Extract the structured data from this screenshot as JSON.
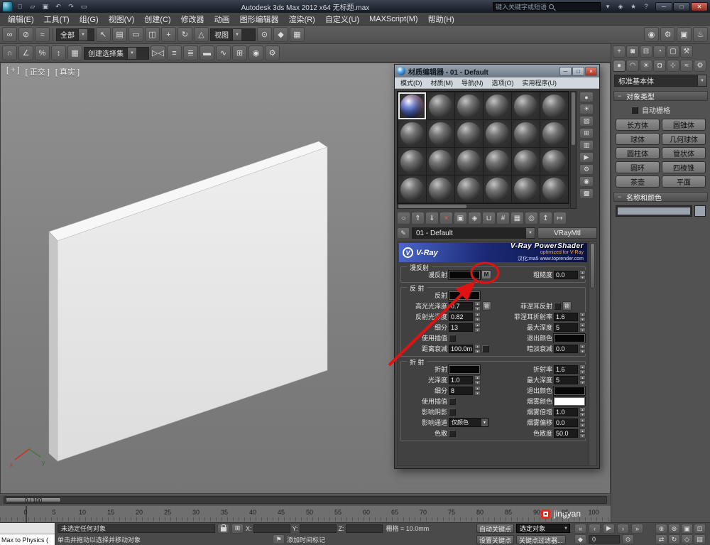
{
  "colors": {
    "annotation": "#e01212",
    "vray_banner_blue": "#16246e",
    "selected_slot_border": "#e8e8e8"
  },
  "titlebar": {
    "title": "Autodesk 3ds Max  2012 x64  无标题.max",
    "search_placeholder": "键入关键字或短语",
    "qat": [
      {
        "name": "new-scene-icon",
        "glyph": "□"
      },
      {
        "name": "open-file-icon",
        "glyph": "▱"
      },
      {
        "name": "save-file-icon",
        "glyph": "▣"
      },
      {
        "name": "undo-icon",
        "glyph": "↶"
      },
      {
        "name": "redo-icon",
        "glyph": "↷"
      },
      {
        "name": "project-folder-icon",
        "glyph": "▭"
      }
    ],
    "right_icons": [
      {
        "name": "search-dropdown-icon",
        "glyph": "▾"
      },
      {
        "name": "communication-center-icon",
        "glyph": "◈"
      },
      {
        "name": "favorites-star-icon",
        "glyph": "★"
      },
      {
        "name": "help-icon",
        "glyph": "?"
      }
    ],
    "window_buttons": [
      {
        "name": "minimize-button",
        "glyph": "─"
      },
      {
        "name": "maximize-button",
        "glyph": "□"
      },
      {
        "name": "close-button",
        "glyph": "✕",
        "cls": "close"
      }
    ]
  },
  "menubar": [
    "编辑(E)",
    "工具(T)",
    "组(G)",
    "视图(V)",
    "创建(C)",
    "修改器",
    "动画",
    "图形编辑器",
    "渲染(R)",
    "自定义(U)",
    "MAXScript(M)",
    "帮助(H)"
  ],
  "toolbar1": {
    "filter_value": "全部",
    "coordsys_value": "视图",
    "group1": [
      {
        "name": "select-and-link-icon",
        "glyph": "∞"
      },
      {
        "name": "unlink-selection-icon",
        "glyph": "⊘"
      },
      {
        "name": "bind-to-space-warp-icon",
        "glyph": "≈"
      }
    ],
    "group2": [
      {
        "name": "select-object-icon",
        "glyph": "↖"
      },
      {
        "name": "select-by-name-icon",
        "glyph": "▤"
      },
      {
        "name": "selection-region-icon",
        "glyph": "▭"
      },
      {
        "name": "window-crossing-icon",
        "glyph": "◫"
      },
      {
        "name": "select-and-move-icon",
        "glyph": "+"
      },
      {
        "name": "select-and-rotate-icon",
        "glyph": "↻"
      },
      {
        "name": "select-and-scale-icon",
        "glyph": "△"
      }
    ],
    "group3": [
      {
        "name": "use-pivot-center-icon",
        "glyph": "⊙"
      },
      {
        "name": "select-and-manipulate-icon",
        "glyph": "◆"
      },
      {
        "name": "keyboard-override-icon",
        "glyph": "▦"
      }
    ],
    "group4": [
      {
        "name": "material-editor-icon",
        "glyph": "◉"
      },
      {
        "name": "render-setup-icon",
        "glyph": "⚙"
      },
      {
        "name": "rendered-frame-window-icon",
        "glyph": "▣"
      },
      {
        "name": "render-production-icon",
        "glyph": "♨"
      }
    ]
  },
  "toolbar2": {
    "selection_set_value": "创建选择集",
    "group1": [
      {
        "name": "snap-toggle-icon",
        "glyph": "∩"
      },
      {
        "name": "angle-snap-icon",
        "glyph": "∠"
      },
      {
        "name": "percent-snap-icon",
        "glyph": "%"
      },
      {
        "name": "spinner-snap-icon",
        "glyph": "↕"
      },
      {
        "name": "edit-named-selection-sets-icon",
        "glyph": "▦"
      }
    ],
    "group2": [
      {
        "name": "mirror-icon",
        "glyph": "▷◁"
      },
      {
        "name": "align-icon",
        "glyph": "≡"
      },
      {
        "name": "layer-manager-icon",
        "glyph": "≣"
      },
      {
        "name": "graphite-ribbon-icon",
        "glyph": "▬"
      },
      {
        "name": "curve-editor-icon",
        "glyph": "∿"
      },
      {
        "name": "schematic-view-icon",
        "glyph": "⊞"
      },
      {
        "name": "material-editor-icon",
        "glyph": "◉"
      },
      {
        "name": "render-setup-icon",
        "glyph": "⚙"
      }
    ]
  },
  "viewport": {
    "label_items": [
      "[ + ]",
      "[ 正交 ]",
      "[ 真实 ]"
    ],
    "axis_x": "x",
    "axis_y": "y"
  },
  "material_editor": {
    "title": "材质编辑器 - 01 - Default",
    "menu": [
      "模式(D)",
      "材质(M)",
      "导航(N)",
      "选项(O)",
      "实用程序(U)"
    ],
    "window_buttons": [
      {
        "name": "me-minimize-button",
        "glyph": "─"
      },
      {
        "name": "me-maximize-button",
        "glyph": "□"
      },
      {
        "name": "me-close-button",
        "glyph": "×",
        "cls": "close"
      }
    ],
    "slots": {
      "rows": 4,
      "cols": 6
    },
    "side_tools": [
      {
        "name": "sample-type-icon",
        "glyph": "●"
      },
      {
        "name": "backlight-icon",
        "glyph": "☀"
      },
      {
        "name": "background-icon",
        "glyph": "▨"
      },
      {
        "name": "sample-tiling-icon",
        "glyph": "⊞"
      },
      {
        "name": "video-color-check-icon",
        "glyph": "▥"
      },
      {
        "name": "make-preview-icon",
        "glyph": "▶"
      },
      {
        "name": "options-icon",
        "glyph": "⚙"
      },
      {
        "name": "select-by-material-icon",
        "glyph": "◉"
      },
      {
        "name": "material-map-navigator-icon",
        "glyph": "▩"
      }
    ],
    "toolbar": [
      {
        "name": "get-material-icon",
        "glyph": "○"
      },
      {
        "name": "put-material-to-scene-icon",
        "glyph": "⇑"
      },
      {
        "name": "assign-material-to-selection-icon",
        "glyph": "⇓"
      },
      {
        "name": "reset-map-icon",
        "glyph": "×",
        "color": "#ff5a4a"
      },
      {
        "name": "make-material-copy-icon",
        "glyph": "▣"
      },
      {
        "name": "make-unique-icon",
        "glyph": "◈"
      },
      {
        "name": "put-to-library-icon",
        "glyph": "⊔"
      },
      {
        "name": "material-id-channel-icon",
        "glyph": "#"
      },
      {
        "name": "show-map-in-viewport-icon",
        "glyph": "▦"
      },
      {
        "name": "show-end-result-icon",
        "glyph": "◎"
      },
      {
        "name": "go-to-parent-icon",
        "glyph": "↥"
      },
      {
        "name": "go-forward-to-sibling-icon",
        "glyph": "↦"
      }
    ],
    "pick_tool": [
      {
        "name": "pick-material-from-object-icon",
        "glyph": "✎"
      }
    ],
    "material_name": "01 - Default",
    "material_type": "VRayMtl",
    "banner": {
      "logo_letter": "V",
      "logo_text": "V-Ray",
      "title": "V-Ray PowerShader",
      "subtitle": "optimized for V-Ray",
      "line2": "汉化:ma5  www.toprender.com"
    },
    "diffuse": {
      "header": "漫反射",
      "rows": [
        {
          "left": {
            "label": "漫反射",
            "swatch": "#070707",
            "map": "M",
            "map_name": "diffuse-map-button"
          },
          "right": {
            "label": "粗糙度",
            "value": "0.0"
          }
        }
      ]
    },
    "reflection": {
      "header": "反 射",
      "rows": [
        {
          "left": {
            "label": "反射",
            "swatch": "#070707"
          },
          "right": null
        },
        {
          "left": {
            "label": "高光光泽度",
            "value": "0.7",
            "lock": "锁"
          },
          "right": {
            "label": "菲涅耳反射",
            "checkbox": true,
            "lock": "锁"
          }
        },
        {
          "left": {
            "label": "反射光泽度",
            "value": "0.82"
          },
          "right": {
            "label": "菲涅耳折射率",
            "value": "1.6"
          }
        },
        {
          "left": {
            "label": "细分",
            "value": "13"
          },
          "right": {
            "label": "最大深度",
            "value": "5"
          }
        },
        {
          "left": {
            "label": "使用插值",
            "checkbox": true
          },
          "right": {
            "label": "退出颜色",
            "swatch": "#070707"
          }
        },
        {
          "left": {
            "label": "距离衰减",
            "value": "100.0m",
            "checkbox": true
          },
          "right": {
            "label": "暗淡衰减",
            "value": "0.0"
          }
        }
      ]
    },
    "refraction": {
      "header": "折 射",
      "rows": [
        {
          "left": {
            "label": "折射",
            "swatch": "#070707"
          },
          "right": {
            "label": "折射率",
            "value": "1.6"
          }
        },
        {
          "left": {
            "label": "光泽度",
            "value": "1.0"
          },
          "right": {
            "label": "最大深度",
            "value": "5"
          }
        },
        {
          "left": {
            "label": "细分",
            "value": "8"
          },
          "right": {
            "label": "退出颜色",
            "swatch": "#070707"
          }
        },
        {
          "left": {
            "label": "使用插值",
            "checkbox": true
          },
          "right": {
            "label": "烟雾颜色",
            "swatch": "#ffffff"
          }
        },
        {
          "left": {
            "label": "影响阴影",
            "checkbox": true
          },
          "right": {
            "label": "烟雾倍增",
            "value": "1.0"
          }
        },
        {
          "left": {
            "label": "影响通道",
            "dropdown": "仅颜色"
          },
          "right": {
            "label": "烟雾偏移",
            "value": "0.0"
          }
        },
        {
          "left": {
            "label": "色散",
            "checkbox": true
          },
          "right": {
            "label": "色散度",
            "value": "50.0"
          }
        }
      ]
    }
  },
  "command_panel": {
    "tabs": [
      {
        "name": "tab-create-icon",
        "glyph": "+"
      },
      {
        "name": "tab-modify-icon",
        "glyph": "◙"
      },
      {
        "name": "tab-hierarchy-icon",
        "glyph": "⊟"
      },
      {
        "name": "tab-motion-icon",
        "glyph": "◔"
      },
      {
        "name": "tab-display-icon",
        "glyph": "▢"
      },
      {
        "name": "tab-utilities-icon",
        "glyph": "⚒"
      }
    ],
    "categories": [
      {
        "name": "category-geometry-icon",
        "glyph": "●"
      },
      {
        "name": "category-shapes-icon",
        "glyph": "◠"
      },
      {
        "name": "category-lights-icon",
        "glyph": "☀"
      },
      {
        "name": "category-cameras-icon",
        "glyph": "◘"
      },
      {
        "name": "category-helpers-icon",
        "glyph": "⊹"
      },
      {
        "name": "category-spacewarps-icon",
        "glyph": "≈"
      },
      {
        "name": "category-systems-icon",
        "glyph": "⚙"
      }
    ],
    "category_dropdown": "标准基本体",
    "object_type": {
      "header": "对象类型",
      "autogrid": "自动栅格",
      "buttons": [
        {
          "name": "box-button",
          "label": "长方体"
        },
        {
          "name": "cone-button",
          "label": "圆锥体"
        },
        {
          "name": "sphere-button",
          "label": "球体"
        },
        {
          "name": "geosphere-button",
          "label": "几何球体"
        },
        {
          "name": "cylinder-button",
          "label": "圆柱体"
        },
        {
          "name": "tube-button",
          "label": "管状体"
        },
        {
          "name": "torus-button",
          "label": "圆环"
        },
        {
          "name": "pyramid-button",
          "label": "四棱锥"
        },
        {
          "name": "teapot-button",
          "label": "茶壶"
        },
        {
          "name": "plane-button",
          "label": "平面"
        }
      ]
    },
    "name_color": {
      "header": "名称和颜色"
    }
  },
  "timeline": {
    "slider_label": "0 / 100",
    "ticks": [
      "0",
      "5",
      "10",
      "15",
      "20",
      "25",
      "30",
      "35",
      "40",
      "45",
      "50",
      "55",
      "60",
      "65",
      "70",
      "75",
      "80",
      "85",
      "90",
      "95",
      "100"
    ],
    "watermark": "jingyan"
  },
  "statusbar": {
    "mini_listener_text": "Max to Physics (",
    "status_line": "未选定任何对象",
    "coord_labels": [
      "X:",
      "Y:",
      "Z:"
    ],
    "coord_values": [
      "",
      "",
      ""
    ],
    "grid_label": "栅格 = 10.0mm",
    "prompt": "单击并拖动以选择并移动对象",
    "time_tag": "添加时间标记",
    "autokey": "自动关键点",
    "setkey": "设置关键点",
    "selection_set": "选定对象",
    "key_filters": "关键点过滤器...",
    "frame_value": "0",
    "abs_icon": [
      {
        "name": "absolute-mode-toggle-icon",
        "glyph": "⊞"
      }
    ],
    "flag_icon": [
      {
        "name": "time-tag-icon",
        "glyph": "⚑"
      }
    ],
    "play_icons": [
      {
        "name": "go-to-start-icon",
        "glyph": "«"
      },
      {
        "name": "previous-frame-icon",
        "glyph": "‹"
      },
      {
        "name": "play-animation-icon",
        "glyph": "▶"
      },
      {
        "name": "next-frame-icon",
        "glyph": "›"
      },
      {
        "name": "go-to-end-icon",
        "glyph": "»"
      }
    ],
    "key_icons": [
      {
        "name": "key-mode-toggle-icon",
        "glyph": "◆"
      }
    ],
    "timecfg_icon": [
      {
        "name": "time-configuration-icon",
        "glyph": "⊙"
      }
    ],
    "nav_icons": [
      {
        "name": "zoom-icon",
        "glyph": "⊕"
      },
      {
        "name": "zoom-all-icon",
        "glyph": "⊛"
      },
      {
        "name": "zoom-extents-icon",
        "glyph": "▣"
      },
      {
        "name": "zoom-region-icon",
        "glyph": "⊡"
      },
      {
        "name": "pan-icon",
        "glyph": "⇄"
      },
      {
        "name": "orbit-icon",
        "glyph": "↻"
      },
      {
        "name": "field-of-view-icon",
        "glyph": "◇"
      },
      {
        "name": "maximize-viewport-icon",
        "glyph": "▤"
      }
    ]
  }
}
